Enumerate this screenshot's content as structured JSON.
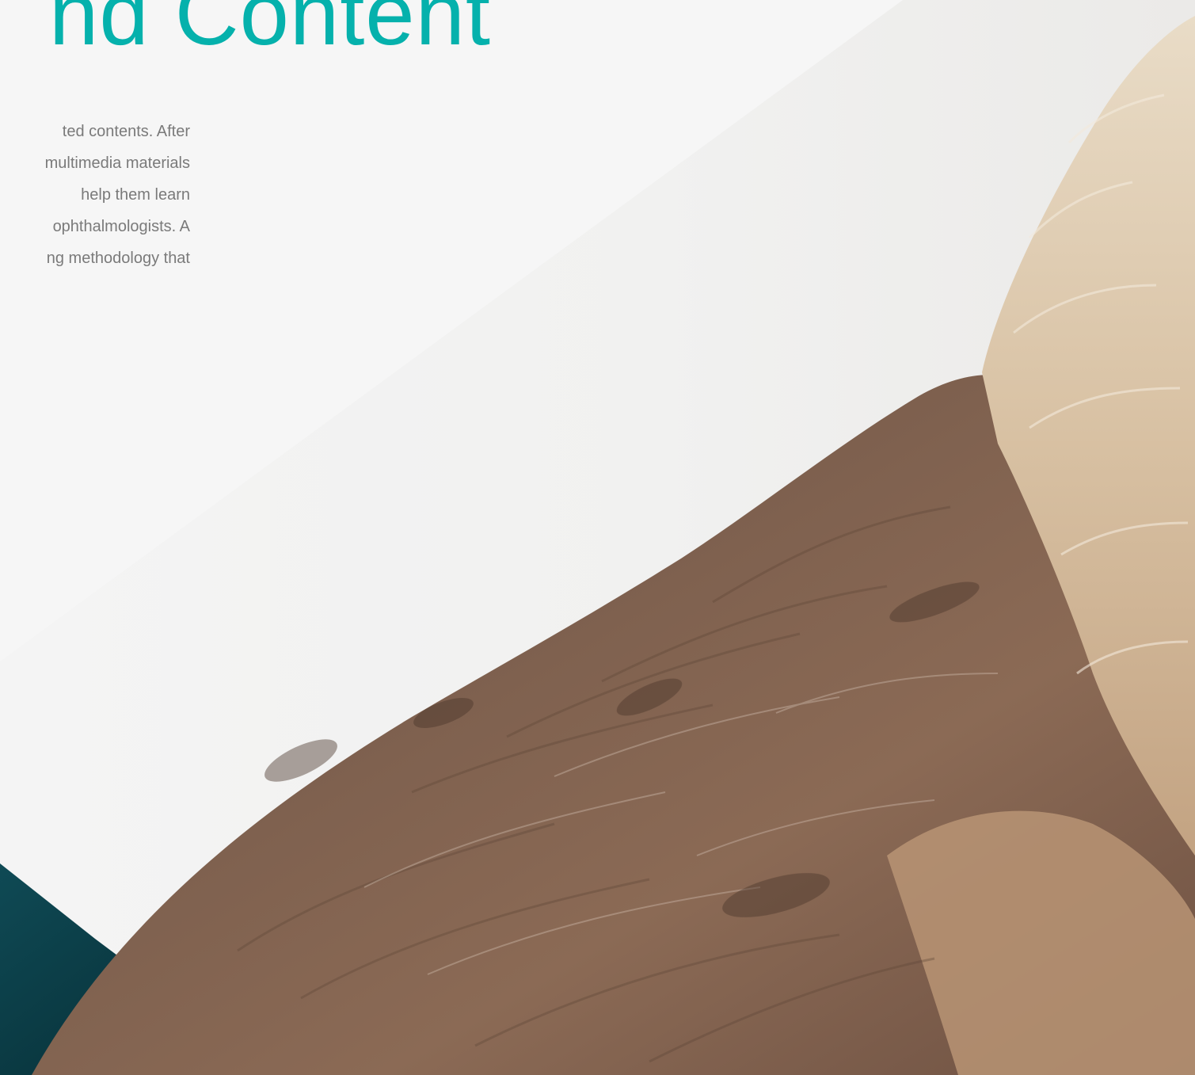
{
  "headline": {
    "text": "nd Content"
  },
  "body": {
    "lines": [
      "ted contents. After",
      "multimedia materials",
      "help them learn",
      "ophthalmologists. A",
      "ng methodology that"
    ]
  },
  "colors": {
    "accent": "#05b1ac",
    "body_text": "#7a7a7a",
    "background": "#f6f6f6",
    "dark_corner": "#0b3b44"
  },
  "images": {
    "background_photo": "brown-feathered-bird-wing-photo"
  }
}
